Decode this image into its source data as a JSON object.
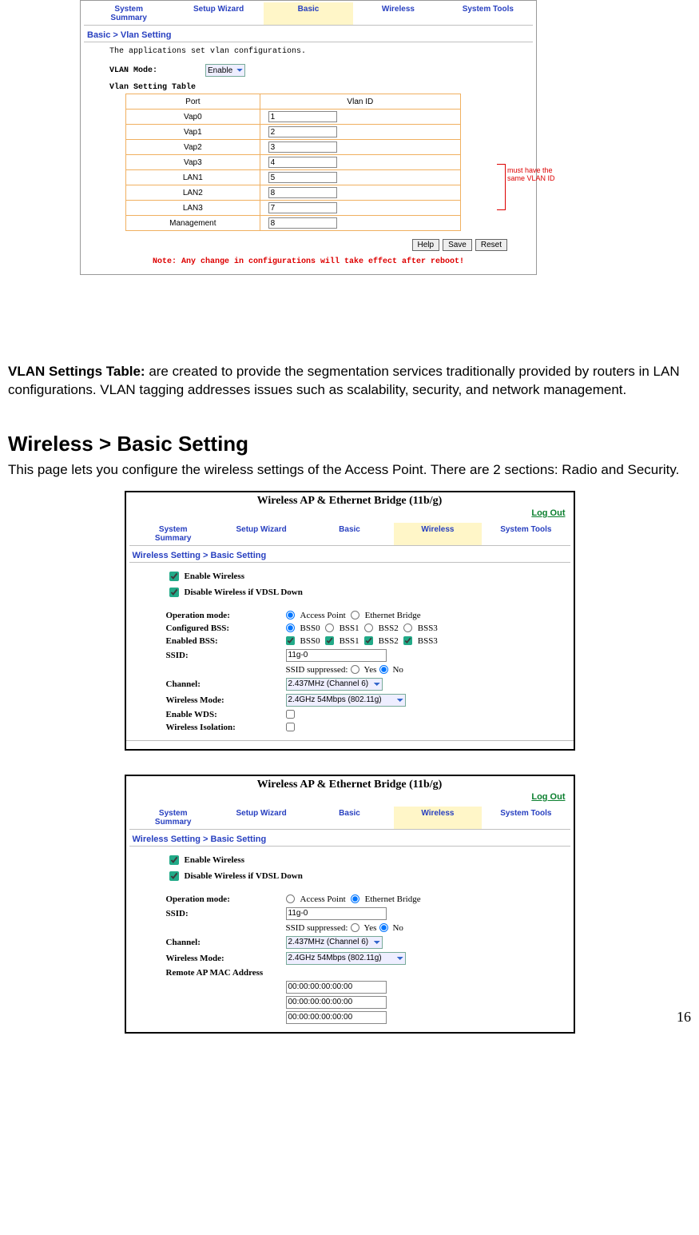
{
  "pagenum": "16",
  "vlan": {
    "tabs": [
      "System\nSummary",
      "Setup Wizard",
      "Basic",
      "Wireless",
      "System Tools"
    ],
    "active_tab_index": 2,
    "breadcrumb": "Basic > Vlan Setting",
    "desc": "The applications set vlan configurations.",
    "mode_label": "VLAN Mode:",
    "mode_value": "Enable",
    "table_heading": "Vlan Setting Table",
    "cols": [
      "Port",
      "Vlan ID"
    ],
    "rows": [
      {
        "port": "Vap0",
        "vid": "1"
      },
      {
        "port": "Vap1",
        "vid": "2"
      },
      {
        "port": "Vap2",
        "vid": "3"
      },
      {
        "port": "Vap3",
        "vid": "4"
      },
      {
        "port": "LAN1",
        "vid": "5"
      },
      {
        "port": "LAN2",
        "vid": "8"
      },
      {
        "port": "LAN3",
        "vid": "7"
      },
      {
        "port": "Management",
        "vid": "8"
      }
    ],
    "annotation": "must have the same VLAN ID",
    "buttons": [
      "Help",
      "Save",
      "Reset"
    ],
    "note": "Note: Any change in configurations will take effect after reboot!"
  },
  "doc": {
    "para1_bold": "VLAN Settings Table:",
    "para1_rest": " are created to provide the segmentation services traditionally provided by routers in LAN configurations. VLAN tagging addresses issues such as scalability, security, and network management.",
    "h2": "Wireless > Basic Setting",
    "para2": "This page lets you configure the wireless settings of the Access Point. There are 2 sections: Radio and Security."
  },
  "wshot_common": {
    "title": "Wireless AP & Ethernet Bridge (11b/g)",
    "logout": "Log Out",
    "tabs": [
      "System\nSummary",
      "Setup Wizard",
      "Basic",
      "Wireless",
      "System Tools"
    ],
    "active_tab_index": 3,
    "breadcrumb": "Wireless Setting > Basic Setting",
    "chk1": "Enable Wireless",
    "chk2": "Disable Wireless if VDSL Down"
  },
  "wshot1": {
    "opmode_label": "Operation mode:",
    "opmode_opts": [
      "Access Point",
      "Ethernet Bridge"
    ],
    "opmode_sel": 0,
    "cfg_bss_label": "Configured BSS:",
    "bss_opts": [
      "BSS0",
      "BSS1",
      "BSS2",
      "BSS3"
    ],
    "cfg_bss_sel": 0,
    "en_bss_label": "Enabled BSS:",
    "en_bss_checked": [
      true,
      true,
      true,
      true
    ],
    "ssid_label": "SSID:",
    "ssid": "11g-0",
    "ssid_supp_label": "SSID suppressed:",
    "ssid_supp_opts": [
      "Yes",
      "No"
    ],
    "ssid_supp_sel": 1,
    "channel_label": "Channel:",
    "channel": "2.437MHz (Channel 6)",
    "wmode_label": "Wireless Mode:",
    "wmode": "2.4GHz 54Mbps (802.11g)",
    "wds_label": "Enable WDS:",
    "iso_label": "Wireless Isolation:"
  },
  "wshot2": {
    "opmode_label": "Operation mode:",
    "opmode_opts": [
      "Access Point",
      "Ethernet Bridge"
    ],
    "opmode_sel": 1,
    "ssid_label": "SSID:",
    "ssid": "11g-0",
    "ssid_supp_label": "SSID suppressed:",
    "ssid_supp_opts": [
      "Yes",
      "No"
    ],
    "ssid_supp_sel": 1,
    "channel_label": "Channel:",
    "channel": "2.437MHz (Channel 6)",
    "wmode_label": "Wireless Mode:",
    "wmode": "2.4GHz 54Mbps (802.11g)",
    "mac_label": "Remote AP MAC Address",
    "macs": [
      "00:00:00:00:00:00",
      "00:00:00:00:00:00",
      "00:00:00:00:00:00"
    ]
  }
}
